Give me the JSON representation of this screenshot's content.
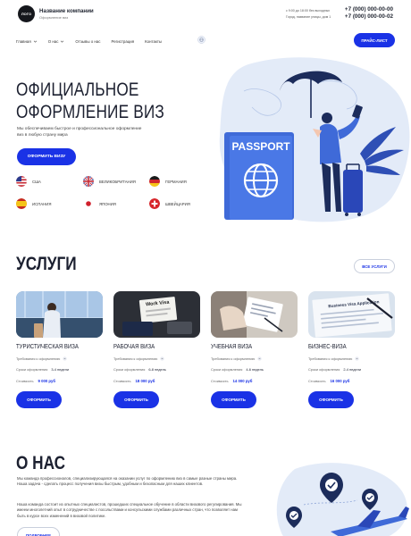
{
  "header": {
    "logo_text": "ЛОГО",
    "company_name": "Название компании",
    "company_subtitle": "Оформление виз",
    "hours": "с 9:00 до 18:00 без выходных",
    "address": "Город, название улицы, дом 1",
    "phones": [
      "+7 (000) 000-00-00",
      "+7 (000) 000-00-02"
    ]
  },
  "nav": {
    "items": [
      "Главная",
      "О нас",
      "Отзывы о нас",
      "Регистрация",
      "Контакты"
    ],
    "price_button": "ПРАЙС-ЛИСТ"
  },
  "hero": {
    "title_lines": [
      "ОФИЦИАЛЬНОЕ",
      "ОФОРМЛЕНИЕ ВИЗ"
    ],
    "description": "Мы обеспечиваем быстрое и профессиональное оформление виз в любую страну мира",
    "button": "ОФОРМИТЬ ВИЗУ",
    "passport_text": "PASSPORT",
    "countries": [
      {
        "name": "США",
        "flag": "usa-flag"
      },
      {
        "name": "ВЕЛИКОБРИТАНИЯ",
        "flag": "uk-flag"
      },
      {
        "name": "ГЕРМАНИЯ",
        "flag": "germany-flag"
      },
      {
        "name": "ИСПАНИЯ",
        "flag": "spain-flag"
      },
      {
        "name": "ЯПОНИЯ",
        "flag": "japan-flag"
      },
      {
        "name": "ШВЕЙЦАРИЯ",
        "flag": "switzerland-flag"
      }
    ]
  },
  "services": {
    "title": "УСЛУГИ",
    "all_button": "ВСЕ УСЛУГИ",
    "requirements_label": "Требования к оформлению",
    "term_label": "Сроки оформления",
    "price_label": "Стоимость",
    "button": "ОФОРМИТЬ",
    "cards": [
      {
        "title": "ТУРИСТИЧЕСКАЯ ВИЗА",
        "term": "3-4 недели",
        "price": "9 000 руб"
      },
      {
        "title": "РАБОЧАЯ ВИЗА",
        "term": "6-8 недель",
        "price": "18 000 руб"
      },
      {
        "title": "УЧЕБНАЯ ВИЗА",
        "term": "4-6 недель",
        "price": "14 000 руб"
      },
      {
        "title": "БИЗНЕС-ВИЗА",
        "term": "2-4 недели",
        "price": "16 000 руб"
      }
    ],
    "card_image_texts": [
      "Work Visa",
      "Business Visa Application"
    ]
  },
  "about": {
    "title": "О НАС",
    "paragraph1": "Мы команда профессионалов, специализирующаяся на оказании услуг по оформлению виз в самые разные страны мира. Наша задача - сделать процесс получения визы быстрым, удобным и безопасным для наших клиентов.",
    "paragraph2": "Наша команда состоит из опытных специалистов, прошедших специальное обучение в области визового регулирования. Мы имеем многолетний опыт в сотрудничестве с посольствами и консульскими службами различных стран, что позволяет нам быть в курсе всех изменений в визовой политике.",
    "button": "ПОДРОБНЕЕ"
  },
  "colors": {
    "accent": "#1a32e6",
    "dark_navy": "#1c2c5b",
    "illustration_blue": "#3f6ad8",
    "light_blue_bg": "#e3ebf8"
  }
}
